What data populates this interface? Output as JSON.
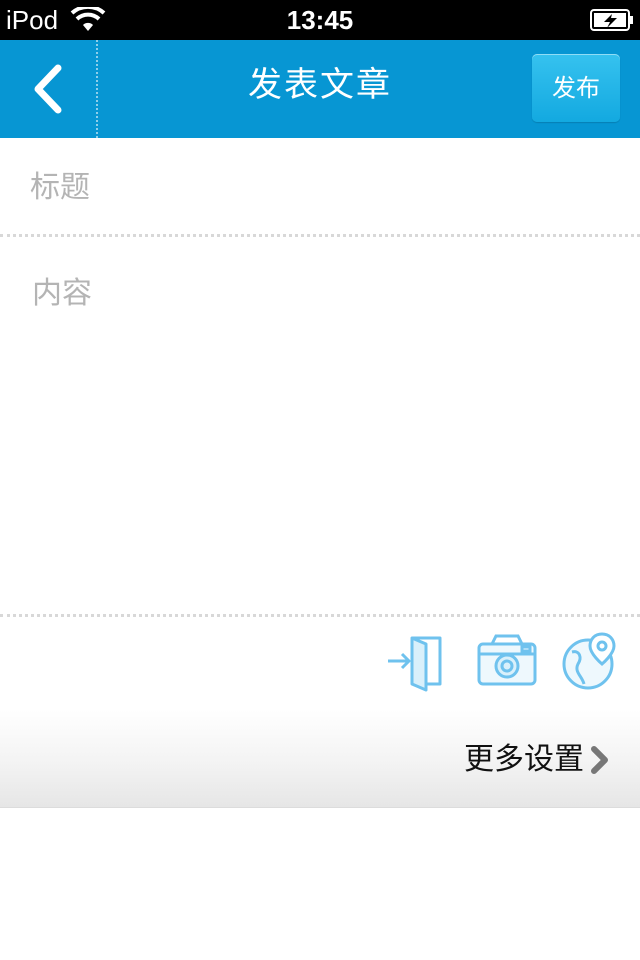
{
  "status_bar": {
    "carrier": "iPod",
    "time": "13:45",
    "icons": [
      "wifi-icon",
      "battery-charging-icon"
    ]
  },
  "nav": {
    "back_icon": "chevron-left-icon",
    "title": "发表文章",
    "publish_label": "发布"
  },
  "form": {
    "title_placeholder": "标题",
    "title_value": "",
    "content_placeholder": "内容",
    "content_value": ""
  },
  "toolbar": {
    "icons": [
      "insert-door-icon",
      "camera-icon",
      "location-globe-icon"
    ]
  },
  "more_settings": {
    "label": "更多设置",
    "icon": "chevron-right-icon"
  },
  "colors": {
    "nav_background": "#0796d3",
    "publish_button": "#1ba9e0",
    "icon_blue": "#6fc2ee"
  }
}
